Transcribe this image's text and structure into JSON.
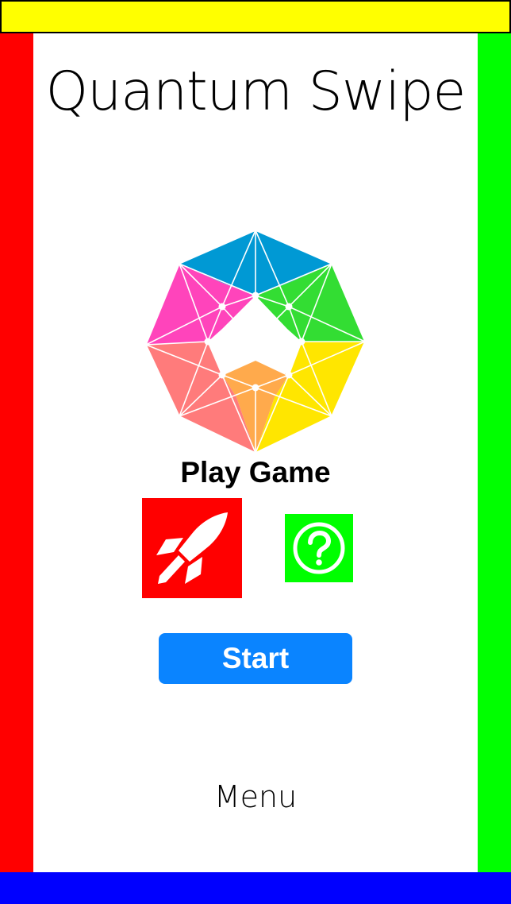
{
  "app": {
    "title": "Quantum Swipe"
  },
  "main": {
    "play_game_label": "Play Game",
    "start_label": "Start",
    "menu_label": "Menu"
  },
  "icons": {
    "logo": "octagon-arrow-logo-icon",
    "rocket": "rocket-icon",
    "help": "question-mark-icon"
  },
  "colors": {
    "top_border": "#ffff00",
    "left_border": "#ff0000",
    "right_border": "#00ff00",
    "bottom_border": "#0000ff",
    "start_button": "#0a84ff",
    "rocket_button": "#ff0000",
    "help_button": "#00ff00"
  }
}
